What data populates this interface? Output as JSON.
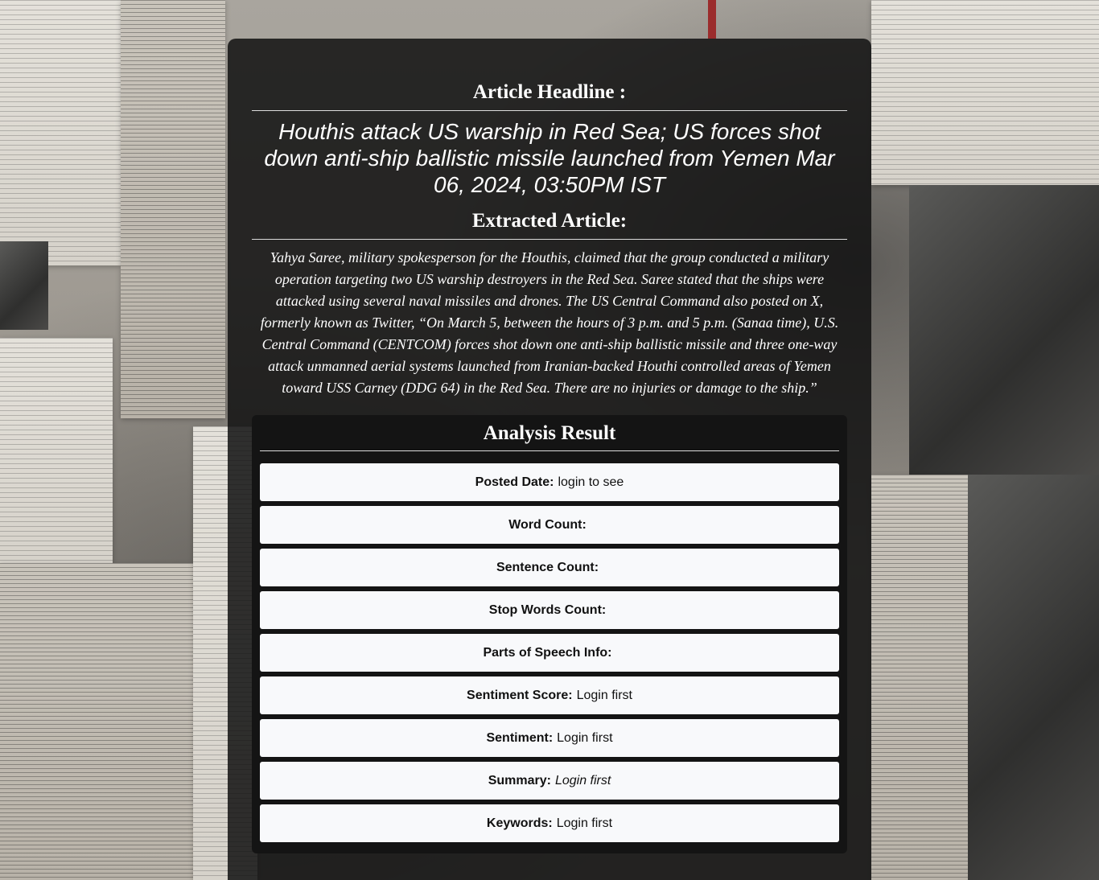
{
  "page": {
    "headline_heading": "Article Headline :",
    "headline_text": "Houthis attack US warship in Red Sea; US forces shot down anti-ship ballistic missile launched from Yemen Mar 06, 2024, 03:50PM IST",
    "extracted_heading": "Extracted Article:",
    "extracted_text": "Yahya Saree, military spokesperson for the Houthis, claimed that the group conducted a military operation targeting two US warship destroyers in the Red Sea. Saree stated that the ships were attacked using several naval missiles and drones. The US Central Command also posted on X, formerly known as Twitter, “On March 5, between the hours of 3 p.m. and 5 p.m. (Sanaa time), U.S. Central Command (CENTCOM) forces shot down one anti-ship ballistic missile and three one-way attack unmanned aerial systems launched from Iranian-backed Houthi controlled areas of Yemen toward USS Carney (DDG 64) in the Red Sea. There are no injuries or damage to the ship.”"
  },
  "analysis": {
    "heading": "Analysis Result",
    "items": [
      {
        "label": "Posted Date:",
        "value": "login to see"
      },
      {
        "label": "Word Count:",
        "value": ""
      },
      {
        "label": "Sentence Count:",
        "value": ""
      },
      {
        "label": "Stop Words Count:",
        "value": ""
      },
      {
        "label": "Parts of Speech Info:",
        "value": ""
      },
      {
        "label": "Sentiment Score:",
        "value": "Login first"
      },
      {
        "label": "Sentiment:",
        "value": "Login first"
      },
      {
        "label": "Summary:",
        "value": "Login first"
      },
      {
        "label": "Keywords:",
        "value": "Login first"
      }
    ]
  },
  "colors": {
    "panel_bg": "#121212",
    "item_bg": "#f8f9fb",
    "text_light": "#ffffff",
    "text_dark": "#111111"
  }
}
